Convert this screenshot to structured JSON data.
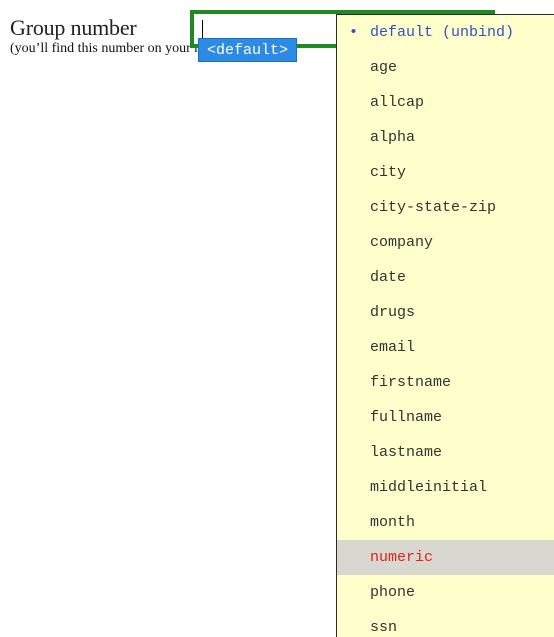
{
  "form": {
    "field_label": "Group number",
    "hint": "(you’ll find this number on your ma",
    "input_value": ""
  },
  "binding": {
    "tag_label": "<default>"
  },
  "dropdown": {
    "bullet": "•",
    "items": [
      {
        "label": "default (unbind)"
      },
      {
        "label": "age"
      },
      {
        "label": "allcap"
      },
      {
        "label": "alpha"
      },
      {
        "label": "city"
      },
      {
        "label": "city-state-zip"
      },
      {
        "label": "company"
      },
      {
        "label": "date"
      },
      {
        "label": "drugs"
      },
      {
        "label": "email"
      },
      {
        "label": "firstname"
      },
      {
        "label": "fullname"
      },
      {
        "label": "lastname"
      },
      {
        "label": "middleinitial"
      },
      {
        "label": "month"
      },
      {
        "label": "numeric"
      },
      {
        "label": "phone"
      },
      {
        "label": "ssn"
      }
    ],
    "selected_index": 0,
    "hover_index": 15
  },
  "colors": {
    "input_border": "#1f8a1f",
    "tag_bg": "#2d8be6",
    "dropdown_bg": "#ffffcc",
    "selected_text": "#3150c9",
    "hover_bg": "#d8d8d0",
    "hover_text": "#e2201c"
  }
}
